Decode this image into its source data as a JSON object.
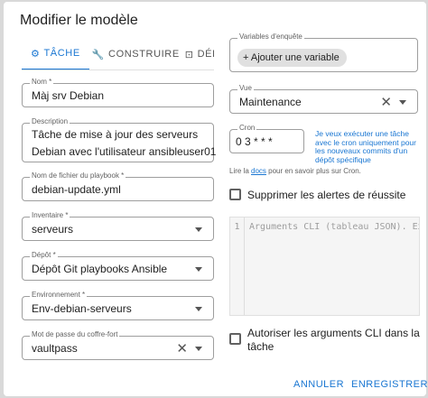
{
  "dialog": {
    "title": "Modifier le modèle"
  },
  "tabs": [
    {
      "label": "TÂCHE",
      "icon": "gear-icon"
    },
    {
      "label": "CONSTRUIRE",
      "icon": "wrench-icon"
    },
    {
      "label": "DÉPLOYER",
      "icon": "deploy-icon"
    }
  ],
  "left": {
    "name": {
      "label": "Nom *",
      "value": "Màj srv Debian"
    },
    "description": {
      "label": "Description",
      "line1": "Tâche de mise à jour des serveurs",
      "line2": "Debian avec l'utilisateur ansibleuser01"
    },
    "playbook": {
      "label": "Nom de fichier du playbook *",
      "value": "debian-update.yml"
    },
    "inventory": {
      "label": "Inventaire *",
      "value": "serveurs"
    },
    "repo": {
      "label": "Dépôt *",
      "value": "Dépôt Git playbooks Ansible"
    },
    "environment": {
      "label": "Environnement *",
      "value": "Env-debian-serveurs"
    },
    "vault": {
      "label": "Mot de passe du coffre-fort",
      "value": "vaultpass"
    }
  },
  "right": {
    "survey": {
      "label": "Variables d'enquête",
      "add_button": "Ajouter une variable"
    },
    "view": {
      "label": "Vue",
      "value": "Maintenance"
    },
    "cron": {
      "label": "Cron",
      "value": "0 3 * * *",
      "hint": "Je veux exécuter une tâche avec le cron uniquement pour les nouveaux commits d'un dépôt spécifique"
    },
    "doc": {
      "prefix": "Lire la ",
      "link": "docs",
      "suffix": " pour en savoir plus sur Cron."
    },
    "suppress": {
      "label": "Supprimer les alertes de réussite"
    },
    "cli": {
      "line_number": "1",
      "placeholder": "Arguments CLI (tableau JSON). Exemple : [\"-i\", \"@myinventory.sh\"]"
    },
    "allow_cli": {
      "label_line1": "Autoriser les arguments CLI dans la",
      "label_line2": "tâche"
    }
  },
  "actions": {
    "cancel": "ANNULER",
    "save": "ENREGISTRER"
  },
  "colors": {
    "accent": "#1976d2"
  }
}
